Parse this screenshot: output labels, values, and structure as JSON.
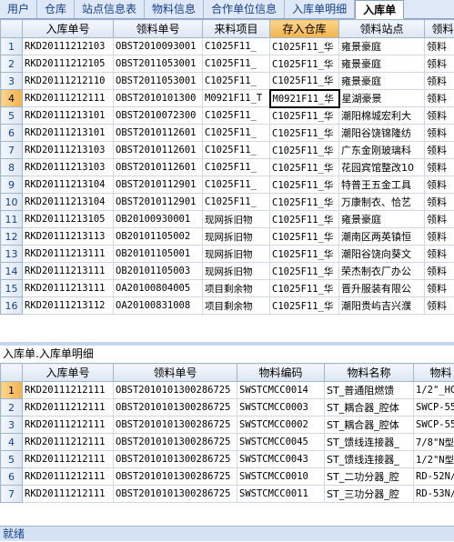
{
  "tabs": [
    "用户",
    "仓库",
    "站点信息表",
    "物料信息",
    "合作单位信息",
    "入库单明细",
    "入库单"
  ],
  "active_tab_index": 6,
  "grid1": {
    "columns": [
      "入库单号",
      "领料单号",
      "来料项目",
      "存入仓库",
      "领料站点",
      "领料"
    ],
    "selected_column": 3,
    "selected_row": 3,
    "rows": [
      {
        "n": "1",
        "c": [
          "RKD20111212103",
          "OBST2010093001",
          "C1025F11_",
          "C1025F11_华",
          "雍景豪庭",
          "领料"
        ]
      },
      {
        "n": "2",
        "c": [
          "RKD20111212105",
          "OBST2011053001",
          "C1025F11_",
          "C1025F11_华",
          "雍景豪庭",
          "领料"
        ]
      },
      {
        "n": "3",
        "c": [
          "RKD20111212110",
          "OBST2011053001",
          "C1025F11_",
          "C1025F11_华",
          "雍景豪庭",
          "领料"
        ]
      },
      {
        "n": "4",
        "c": [
          "RKD20111212111",
          "OBST2010101300",
          "M0921F11_T",
          "M0921F11_华",
          "星湖豪景",
          "领料"
        ]
      },
      {
        "n": "5",
        "c": [
          "RKD20111213101",
          "OBST2010072300",
          "C1025F11_",
          "C1025F11_华",
          "潮阳棉城宏利大",
          "领料"
        ]
      },
      {
        "n": "6",
        "c": [
          "RKD20111213101",
          "OBST2010112601",
          "C1025F11_",
          "C1025F11_华",
          "潮阳谷饶锦隆纺",
          "领料"
        ]
      },
      {
        "n": "7",
        "c": [
          "RKD20111213103",
          "OBST2010112601",
          "C1025F11_",
          "C1025F11_华",
          "广东金刚玻璃科",
          "领料"
        ]
      },
      {
        "n": "8",
        "c": [
          "RKD20111213103",
          "OBST2010112601",
          "C1025F11_",
          "C1025F11_华",
          "花园宾馆整改10",
          "领料"
        ]
      },
      {
        "n": "9",
        "c": [
          "RKD20111213104",
          "OBST2010112901",
          "C1025F11_",
          "C1025F11_华",
          "特普王五金工具",
          "领料"
        ]
      },
      {
        "n": "10",
        "c": [
          "RKD20111213104",
          "OBST2010112901",
          "C1025F11_",
          "C1025F11_华",
          "万康制衣、恰艺",
          "领料"
        ]
      },
      {
        "n": "11",
        "c": [
          "RKD20111213105",
          "OB20100930001",
          "现网拆旧物",
          "C1025F11_华",
          "雍景豪庭",
          "领料"
        ]
      },
      {
        "n": "12",
        "c": [
          "RKD20111213113",
          "OB20101105002",
          "现网拆旧物",
          "C1025F11_华",
          "潮南区两英镇恒",
          "领料"
        ]
      },
      {
        "n": "13",
        "c": [
          "RKD20111213111",
          "OB20101105001",
          "现网拆旧物",
          "C1025F11_华",
          "潮阳谷饶向葵文",
          "领料"
        ]
      },
      {
        "n": "14",
        "c": [
          "RKD20111213111",
          "OB20101105003",
          "现网拆旧物",
          "C1025F11_华",
          "荣杰制衣厂办公",
          "领料"
        ]
      },
      {
        "n": "15",
        "c": [
          "RKD20111213111",
          "OA20100804005",
          "项目剩余物",
          "C1025F11_华",
          "晋升服装有限公",
          "领料"
        ]
      },
      {
        "n": "16",
        "c": [
          "RKD20111213112",
          "OA20100831008",
          "项目剩余物",
          "C1025F11_华",
          "潮阳贵屿吉兴濮",
          "领料"
        ]
      }
    ]
  },
  "mid_title": "入库单.入库单明细",
  "grid2": {
    "columns": [
      "入库单号",
      "领料单号",
      "物料编码",
      "物料名称",
      "物料"
    ],
    "selected_row": 0,
    "rows": [
      {
        "n": "1",
        "c": [
          "RKD20111212111",
          "OBST2010101300286725",
          "SWSTCMCC0014",
          "ST_普通阻燃馈",
          "1/2\"_HC"
        ]
      },
      {
        "n": "2",
        "c": [
          "RKD20111212111",
          "OBST2010101300286725",
          "SWSTCMCC0003",
          "ST_耦合器_腔体",
          "SWCP-55"
        ]
      },
      {
        "n": "3",
        "c": [
          "RKD20111212111",
          "OBST2010101300286725",
          "SWSTCMCC0002",
          "ST_耦合器_腔体",
          "SWCP-55"
        ]
      },
      {
        "n": "4",
        "c": [
          "RKD20111212111",
          "OBST2010101300286725",
          "SWSTCMCC0045",
          "ST_馈线连接器_",
          "7/8\"N型"
        ]
      },
      {
        "n": "5",
        "c": [
          "RKD20111212111",
          "OBST2010101300286725",
          "SWSTCMCC0043",
          "ST_馈线连接器_",
          "1/2\"N型"
        ]
      },
      {
        "n": "6",
        "c": [
          "RKD20111212111",
          "OBST2010101300286725",
          "SWSTCMCC0010",
          "ST_二功分器_腔",
          "RD-52N/"
        ]
      },
      {
        "n": "7",
        "c": [
          "RKD20111212111",
          "OBST2010101300286725",
          "SWSTCMCC0011",
          "ST_三功分器_腔",
          "RD-53N/"
        ]
      }
    ]
  },
  "status": "就绪"
}
